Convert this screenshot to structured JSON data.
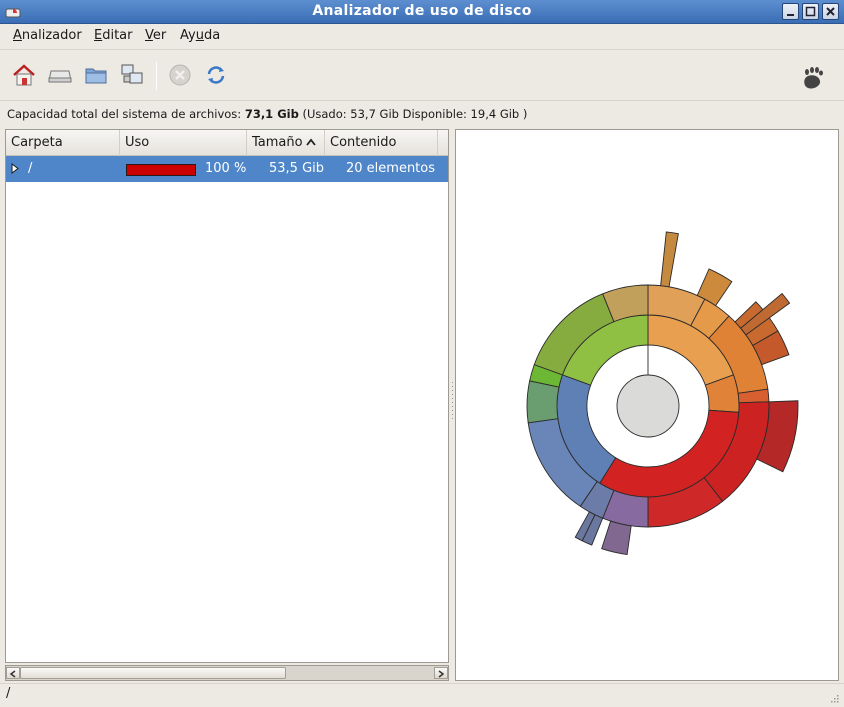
{
  "window": {
    "title": "Analizador de uso de disco"
  },
  "menu": {
    "items": [
      {
        "pre": "",
        "mn": "A",
        "rest": "nalizador"
      },
      {
        "pre": "",
        "mn": "E",
        "rest": "ditar"
      },
      {
        "pre": "",
        "mn": "V",
        "rest": "er"
      },
      {
        "pre": "Ay",
        "mn": "u",
        "rest": "da"
      }
    ]
  },
  "toolbar": {
    "icons": [
      "home-icon",
      "drive-icon",
      "folder-icon",
      "network-icon",
      "stop-icon",
      "refresh-icon",
      "gnome-foot-icon"
    ]
  },
  "capacity": {
    "prefix": "Capacidad total del sistema de archivos:",
    "total": "73,1 Gib",
    "detail": "(Usado: 53,7 Gib Disponible: 19,4 Gib )"
  },
  "tree": {
    "columns": [
      "Carpeta",
      "Uso",
      "Tamaño",
      "Contenido"
    ],
    "rows": [
      {
        "folder": "/",
        "percent": "100 %",
        "size": "53,5 Gib",
        "contents": "20 elementos",
        "usage_fraction": 1.0
      }
    ]
  },
  "status": {
    "text": "/"
  },
  "colors": {
    "selection": "#4f86c9",
    "usage_bar": "#cc0000",
    "titlebar": "#3a6db4"
  }
}
